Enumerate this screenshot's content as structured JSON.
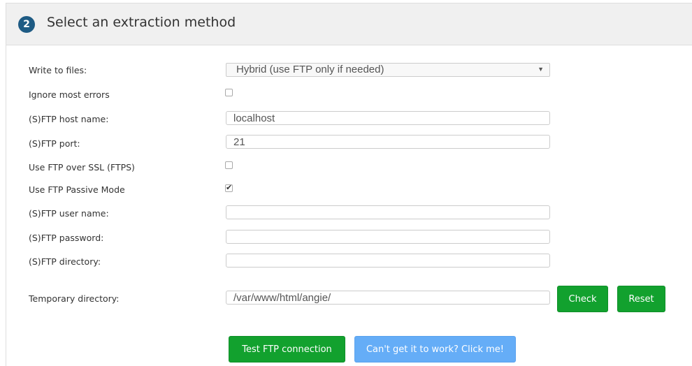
{
  "header": {
    "step": "2",
    "title": "Select an extraction method"
  },
  "form": {
    "write_to_files": {
      "label": "Write to files:",
      "value": "Hybrid (use FTP only if needed)"
    },
    "ignore_errors": {
      "label": "Ignore most errors",
      "checked": false
    },
    "ftp_host": {
      "label": "(S)FTP host name:",
      "value": "localhost"
    },
    "ftp_port": {
      "label": "(S)FTP port:",
      "value": "21"
    },
    "ftps": {
      "label": "Use FTP over SSL (FTPS)",
      "checked": false
    },
    "passive": {
      "label": "Use FTP Passive Mode",
      "checked": true
    },
    "ftp_user": {
      "label": "(S)FTP user name:",
      "value": ""
    },
    "ftp_pass": {
      "label": "(S)FTP password:",
      "value": ""
    },
    "ftp_dir": {
      "label": "(S)FTP directory:",
      "value": ""
    },
    "temp_dir": {
      "label": "Temporary directory:",
      "value": "/var/www/html/angie/"
    }
  },
  "buttons": {
    "check": "Check",
    "reset": "Reset",
    "test_ftp": "Test FTP connection",
    "help": "Can't get it to work? Click me!"
  },
  "colors": {
    "primary_green": "#12a12e",
    "info_blue": "#65adf7",
    "badge": "#1e5b84"
  }
}
